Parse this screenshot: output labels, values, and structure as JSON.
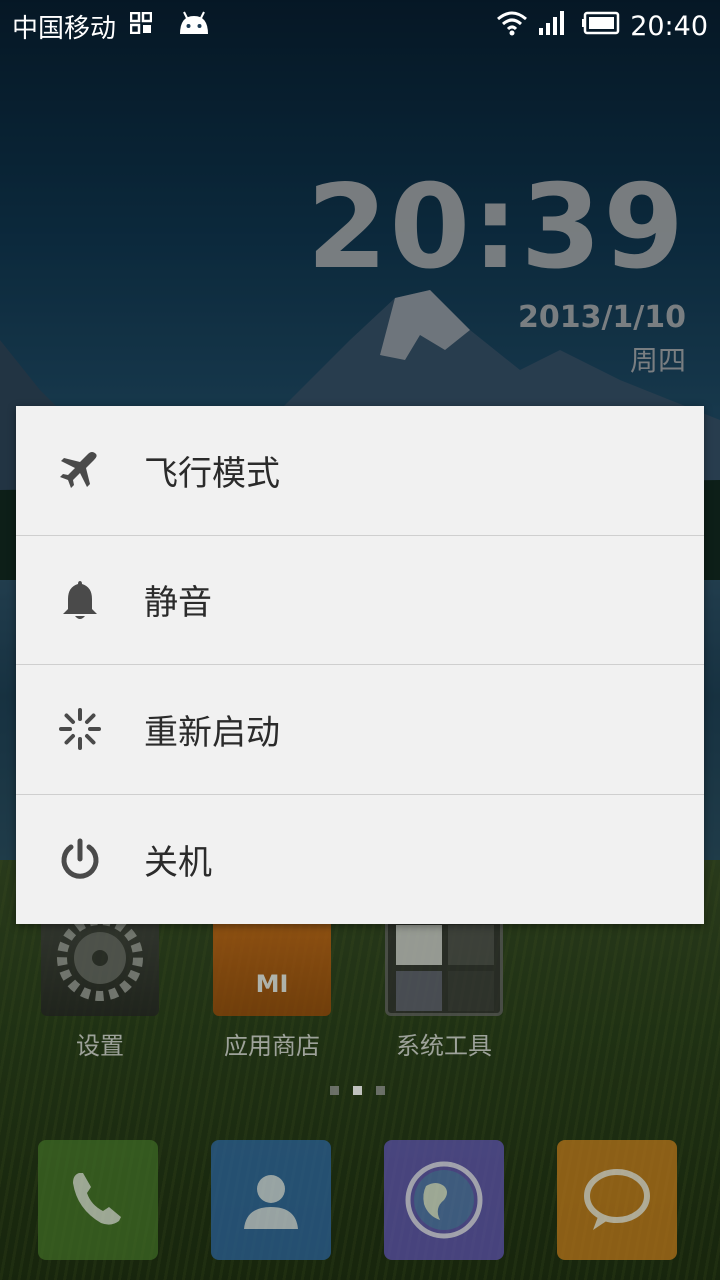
{
  "status_bar": {
    "carrier": "中国移动",
    "time": "20:40",
    "icons": [
      "qr-icon",
      "android-icon",
      "wifi-icon",
      "signal-icon",
      "battery-icon"
    ]
  },
  "clock_widget": {
    "time": "20:39",
    "date": "2013/1/10",
    "day": "周四"
  },
  "power_menu": {
    "items": [
      {
        "label": "飞行模式",
        "icon": "airplane-icon"
      },
      {
        "label": "静音",
        "icon": "bell-icon"
      },
      {
        "label": "重新启动",
        "icon": "restart-icon"
      },
      {
        "label": "关机",
        "icon": "power-icon"
      }
    ]
  },
  "apps": [
    {
      "label": "设置",
      "icon": "settings-icon"
    },
    {
      "label": "应用商店",
      "icon": "app-store-icon",
      "badge": "MI"
    },
    {
      "label": "系统工具",
      "icon": "tools-folder-icon"
    }
  ],
  "dock": [
    {
      "icon": "phone-icon",
      "color": "#3f6b25"
    },
    {
      "icon": "contacts-icon",
      "color": "#2a5f97"
    },
    {
      "icon": "browser-icon",
      "color": "#5a4fa8"
    },
    {
      "icon": "messages-icon",
      "color": "#b8741a"
    }
  ]
}
